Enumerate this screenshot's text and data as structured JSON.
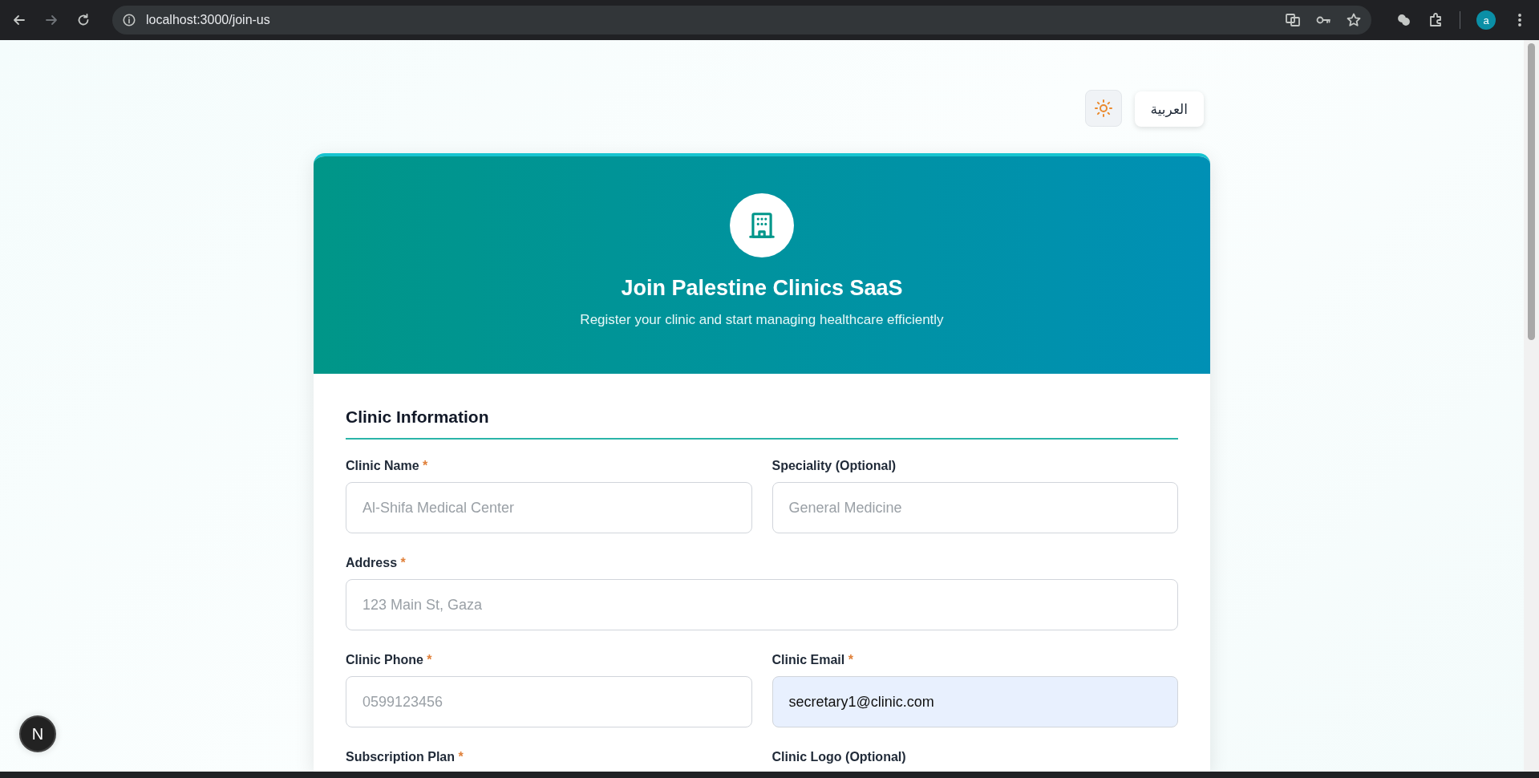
{
  "browser": {
    "url": "localhost:3000/join-us",
    "profile_initial": "a"
  },
  "language_button": "العربية",
  "header": {
    "title": "Join Palestine Clinics SaaS",
    "subtitle": "Register your clinic and start managing healthcare efficiently"
  },
  "section": {
    "title": "Clinic Information",
    "fields": [
      {
        "kind": "half",
        "label": "Clinic Name",
        "required_mark": "*",
        "placeholder": "Al-Shifa Medical Center"
      },
      {
        "kind": "half",
        "label": "Speciality (Optional)",
        "placeholder": "General Medicine"
      },
      {
        "kind": "full",
        "label": "Address",
        "required_mark": "*",
        "placeholder": "123 Main St, Gaza"
      },
      {
        "kind": "half",
        "label": "Clinic Phone",
        "required_mark": "*",
        "placeholder": "0599123456"
      },
      {
        "kind": "half",
        "label": "Clinic Email",
        "required_mark": "*",
        "value": "secretary1@clinic.com",
        "autofilled": true
      },
      {
        "kind": "label",
        "label": "Subscription Plan",
        "required_mark": "*"
      },
      {
        "kind": "label",
        "label": "Clinic Logo (Optional)"
      }
    ]
  },
  "dev_badge": "N"
}
